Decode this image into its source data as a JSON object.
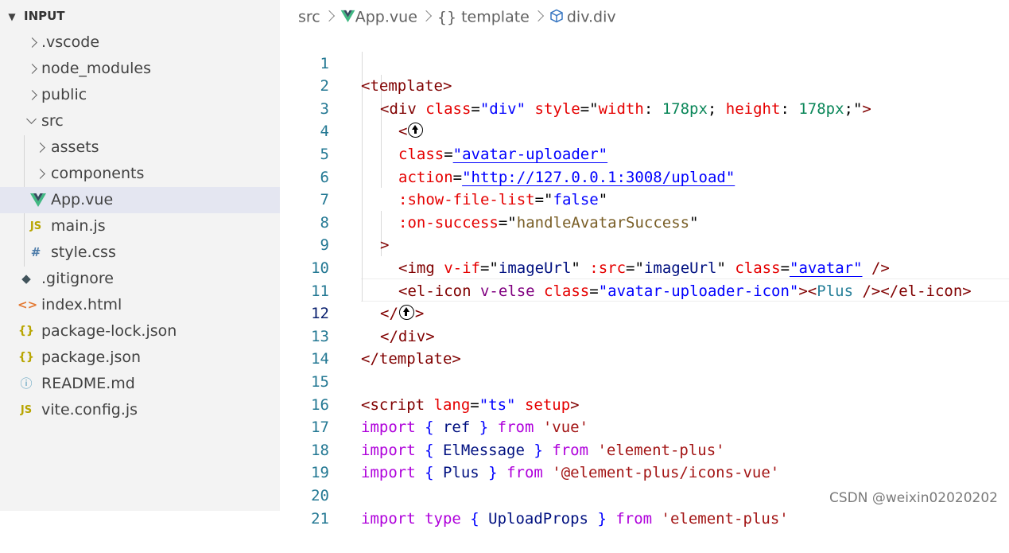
{
  "explorer": {
    "title": "INPUT",
    "items": [
      {
        "label": ".vscode",
        "kind": "folder",
        "icon": "chevron-right-icon"
      },
      {
        "label": "node_modules",
        "kind": "folder",
        "icon": "chevron-right-icon"
      },
      {
        "label": "public",
        "kind": "folder",
        "icon": "chevron-right-icon"
      },
      {
        "label": "src",
        "kind": "folder-open",
        "icon": "chevron-down-icon"
      },
      {
        "label": "assets",
        "kind": "folder",
        "icon": "chevron-right-icon"
      },
      {
        "label": "components",
        "kind": "folder",
        "icon": "chevron-right-icon"
      },
      {
        "label": "App.vue",
        "kind": "file",
        "icon": "vue-icon",
        "selected": true
      },
      {
        "label": "main.js",
        "kind": "file",
        "icon": "js-icon",
        "glyph": "JS"
      },
      {
        "label": "style.css",
        "kind": "file",
        "icon": "css-icon",
        "glyph": "#"
      },
      {
        "label": ".gitignore",
        "kind": "file",
        "icon": "git-icon",
        "glyph": "◆"
      },
      {
        "label": "index.html",
        "kind": "file",
        "icon": "html-icon",
        "glyph": "<>"
      },
      {
        "label": "package-lock.json",
        "kind": "file",
        "icon": "json-icon",
        "glyph": "{}"
      },
      {
        "label": "package.json",
        "kind": "file",
        "icon": "json-icon",
        "glyph": "{}"
      },
      {
        "label": "README.md",
        "kind": "file",
        "icon": "info-icon",
        "glyph": "ⓘ"
      },
      {
        "label": "vite.config.js",
        "kind": "file",
        "icon": "js-icon",
        "glyph": "JS"
      }
    ]
  },
  "breadcrumb": {
    "src": "src",
    "file": "App.vue",
    "template": "template",
    "template_glyph": "{}",
    "element": "div.div"
  },
  "editor": {
    "active_line": 12,
    "line_numbers": [
      "1",
      "2",
      "3",
      "4",
      "5",
      "6",
      "7",
      "8",
      "9",
      "10",
      "11",
      "12",
      "13",
      "14",
      "15",
      "16",
      "17",
      "18",
      "19",
      "20",
      "21"
    ],
    "code": {
      "l1": {
        "t1": "<template>"
      },
      "l2": {
        "t1": "<div",
        "a1": " class",
        "p1": "=",
        "s1": "\"div\"",
        "a2": " style",
        "p2": "=",
        "s2q": "\"",
        "s2a": "width",
        "s2b": ": ",
        "s2c": "178px",
        "s2d": "; ",
        "s2e": "height",
        "s2f": ": ",
        "s2g": "178px",
        "s2h": ";\"",
        "t2": ">"
      },
      "l3": {
        "t1": "<"
      },
      "l4": {
        "a1": "class",
        "p1": "=",
        "s1": "\"avatar-uploader\""
      },
      "l5": {
        "a1": "action",
        "p1": "=",
        "s1": "\"http://127.0.0.1:3008/upload\""
      },
      "l6": {
        "a1": ":show-file-list",
        "p1": "=",
        "q1": "\"",
        "v1": "false",
        "q2": "\""
      },
      "l7": {
        "a1": ":on-success",
        "p1": "=",
        "q1": "\"",
        "v1": "handleAvatarSuccess",
        "q2": "\""
      },
      "l8": {
        "t1": ">"
      },
      "l9": {
        "t1": "<img",
        "a1": " v-if",
        "p1": "=",
        "q1": "\"",
        "v1": "imageUrl",
        "q2": "\"",
        "a2": " :src",
        "p2": "=",
        "q3": "\"",
        "v2": "imageUrl",
        "q4": "\"",
        "a3": " class",
        "p3": "=",
        "s1": "\"avatar\"",
        "t2": " />"
      },
      "l10": {
        "t1": "<el-icon",
        "a1": " v-else",
        "a2": " class",
        "p1": "=",
        "s1": "\"avatar-uploader-icon\"",
        "t2": "><",
        "c1": "Plus",
        "t3": " /></el-icon>"
      },
      "l11": {
        "t1": "</",
        "t2": ">"
      },
      "l12": {
        "t1": "</div>"
      },
      "l13": {
        "t1": "</template>"
      },
      "l15": {
        "t1": "<script",
        "a1": " lang",
        "p1": "=",
        "s1": "\"ts\"",
        "a2": " setup",
        "t2": ">"
      },
      "l16": {
        "k1": "import",
        "b1": " { ",
        "v1": "ref",
        "b2": " } ",
        "k2": "from",
        "s1": " 'vue'"
      },
      "l17": {
        "k1": "import",
        "b1": " { ",
        "v1": "ElMessage",
        "b2": " } ",
        "k2": "from",
        "s1": " 'element-plus'"
      },
      "l18": {
        "k1": "import",
        "b1": " { ",
        "v1": "Plus",
        "b2": " } ",
        "k2": "from",
        "s1": " '@element-plus/icons-vue'"
      },
      "l20": {
        "k1": "import",
        "k2": " type",
        "b1": " { ",
        "v1": "UploadProps",
        "b2": " } ",
        "k3": "from",
        "s1": " 'element-plus'"
      }
    }
  },
  "watermark": "CSDN @weixin02020202",
  "colors": {
    "sidebar_bg": "#f3f3f3",
    "selected_row": "#e4e6f1",
    "line_number": "#237893",
    "tag": "#800000",
    "attribute": "#e50000",
    "string": "#0000ff",
    "keyword": "#af00db"
  }
}
